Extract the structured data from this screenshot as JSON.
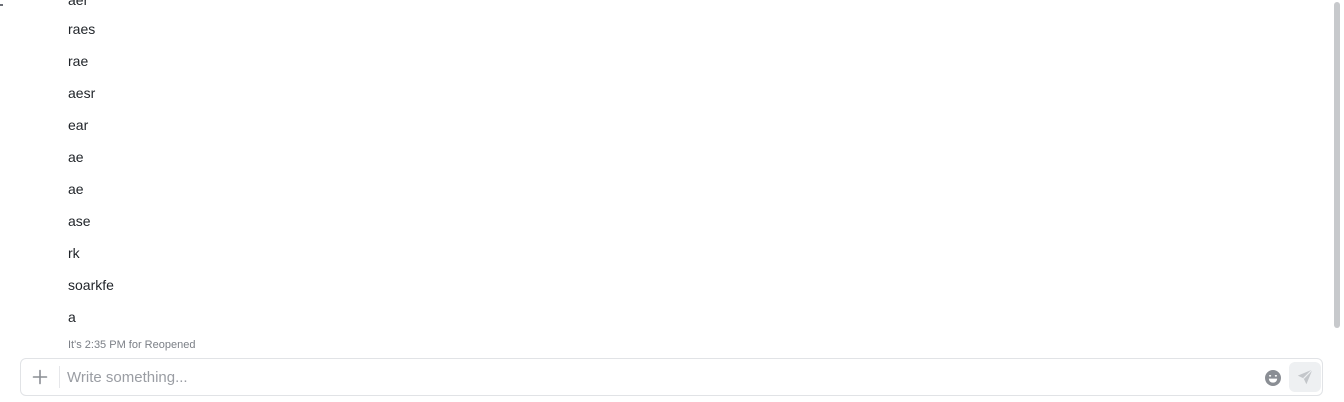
{
  "messages": [
    {
      "text": "aer"
    },
    {
      "text": "raes"
    },
    {
      "text": "rae"
    },
    {
      "text": "aesr"
    },
    {
      "text": "ear"
    },
    {
      "text": "ae"
    },
    {
      "text": "ae"
    },
    {
      "text": "ase"
    },
    {
      "text": "rk"
    },
    {
      "text": "soarkfe"
    },
    {
      "text": "a"
    }
  ],
  "status_line": "It's 2:35 PM for Reopened",
  "composer": {
    "placeholder": "Write something...",
    "add_icon": "plus-icon",
    "emoji_icon": "emoji-icon",
    "send_icon": "send-icon"
  },
  "colors": {
    "text": "#1f2328",
    "muted": "#7b7f86",
    "border": "#e1e3e6",
    "send_bg": "#eef0f2",
    "icon": "#8a8e94"
  }
}
